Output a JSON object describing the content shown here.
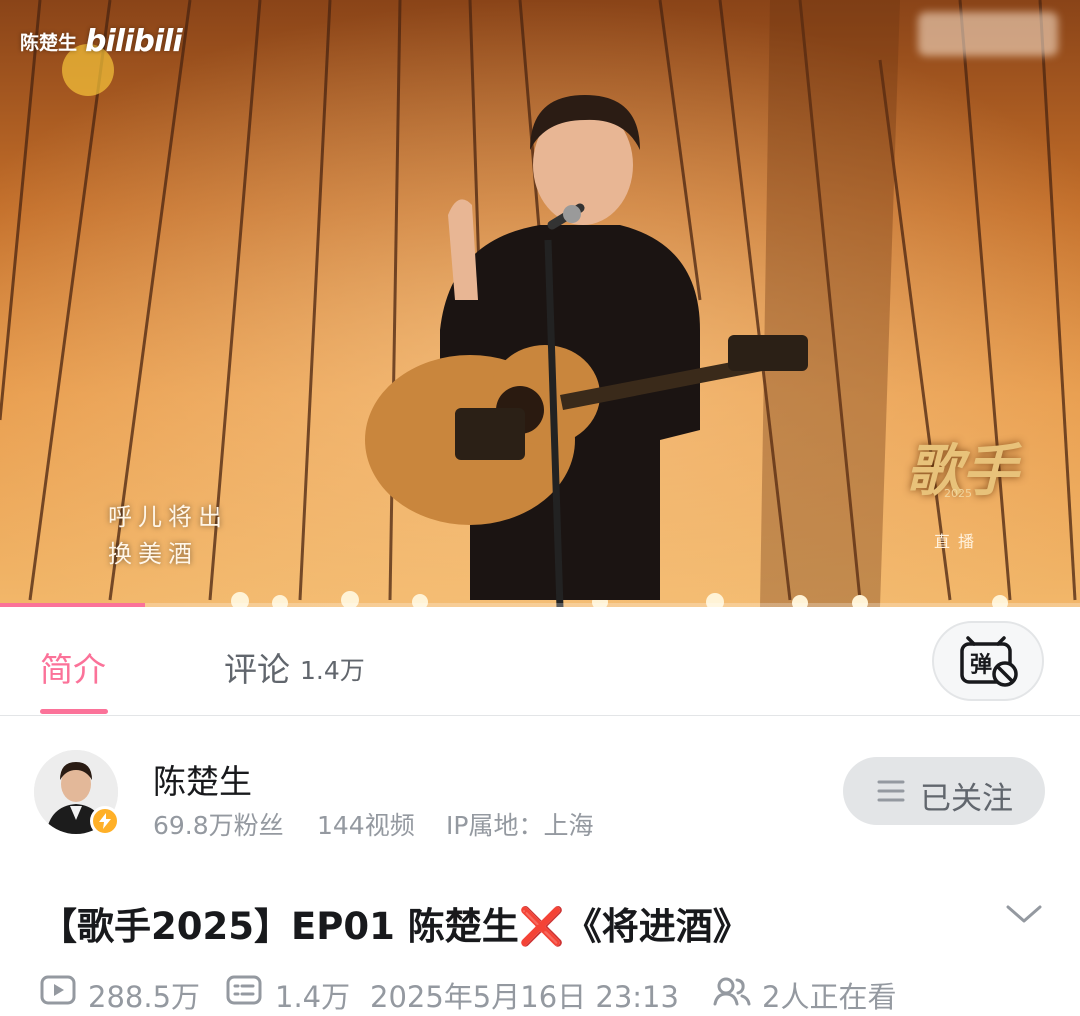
{
  "player": {
    "watermark_name": "陈楚生",
    "watermark_logo": "bilibili",
    "lyrics": [
      "呼儿将出",
      "换美酒"
    ],
    "show_logo": "歌手",
    "show_year": "2025",
    "live_badge": "直播",
    "progress": 0.134
  },
  "tabs": {
    "intro_label": "简介",
    "comments_label": "评论",
    "comments_count": "1.4万"
  },
  "danmaku_button_icon": "danmaku-off-icon",
  "uploader": {
    "name": "陈楚生",
    "followers": "69.8万粉丝",
    "videos": "144视频",
    "ip_location": "IP属地：上海",
    "follow_label": "已关注"
  },
  "video": {
    "title": "【歌手2025】EP01 陈楚生❌《将进酒》",
    "views": "288.5万",
    "danmaku_count": "1.4万",
    "publish_time": "2025年5月16日 23:13",
    "watching": "2人正在看"
  },
  "colors": {
    "accent": "#fb7299",
    "text_primary": "#18191c",
    "text_secondary": "#9499a0",
    "verify_badge": "#ffb027"
  }
}
